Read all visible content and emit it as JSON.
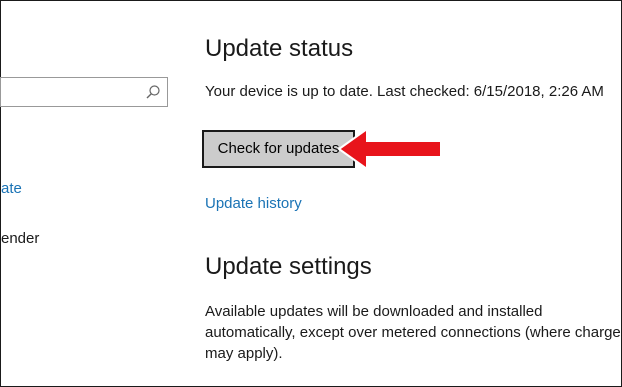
{
  "sidebar": {
    "search_value": "",
    "items": [
      {
        "label": "ate"
      },
      {
        "label": "ender"
      }
    ]
  },
  "main": {
    "status_heading": "Update status",
    "status_text": "Your device is up to date. Last checked: 6/15/2018, 2:26 AM",
    "check_button_label": "Check for updates",
    "history_link": "Update history",
    "settings_heading": "Update settings",
    "settings_description_lines": [
      "Available updates will be downloaded and installed",
      "automatically, except over metered connections (where charges",
      "may apply)."
    ]
  },
  "annotation": {
    "arrow_color": "#e8141b",
    "icon": "left-arrow"
  },
  "colors": {
    "link": "#1a73b5",
    "button_bg": "#cccccc",
    "text": "#1a1a1a"
  }
}
